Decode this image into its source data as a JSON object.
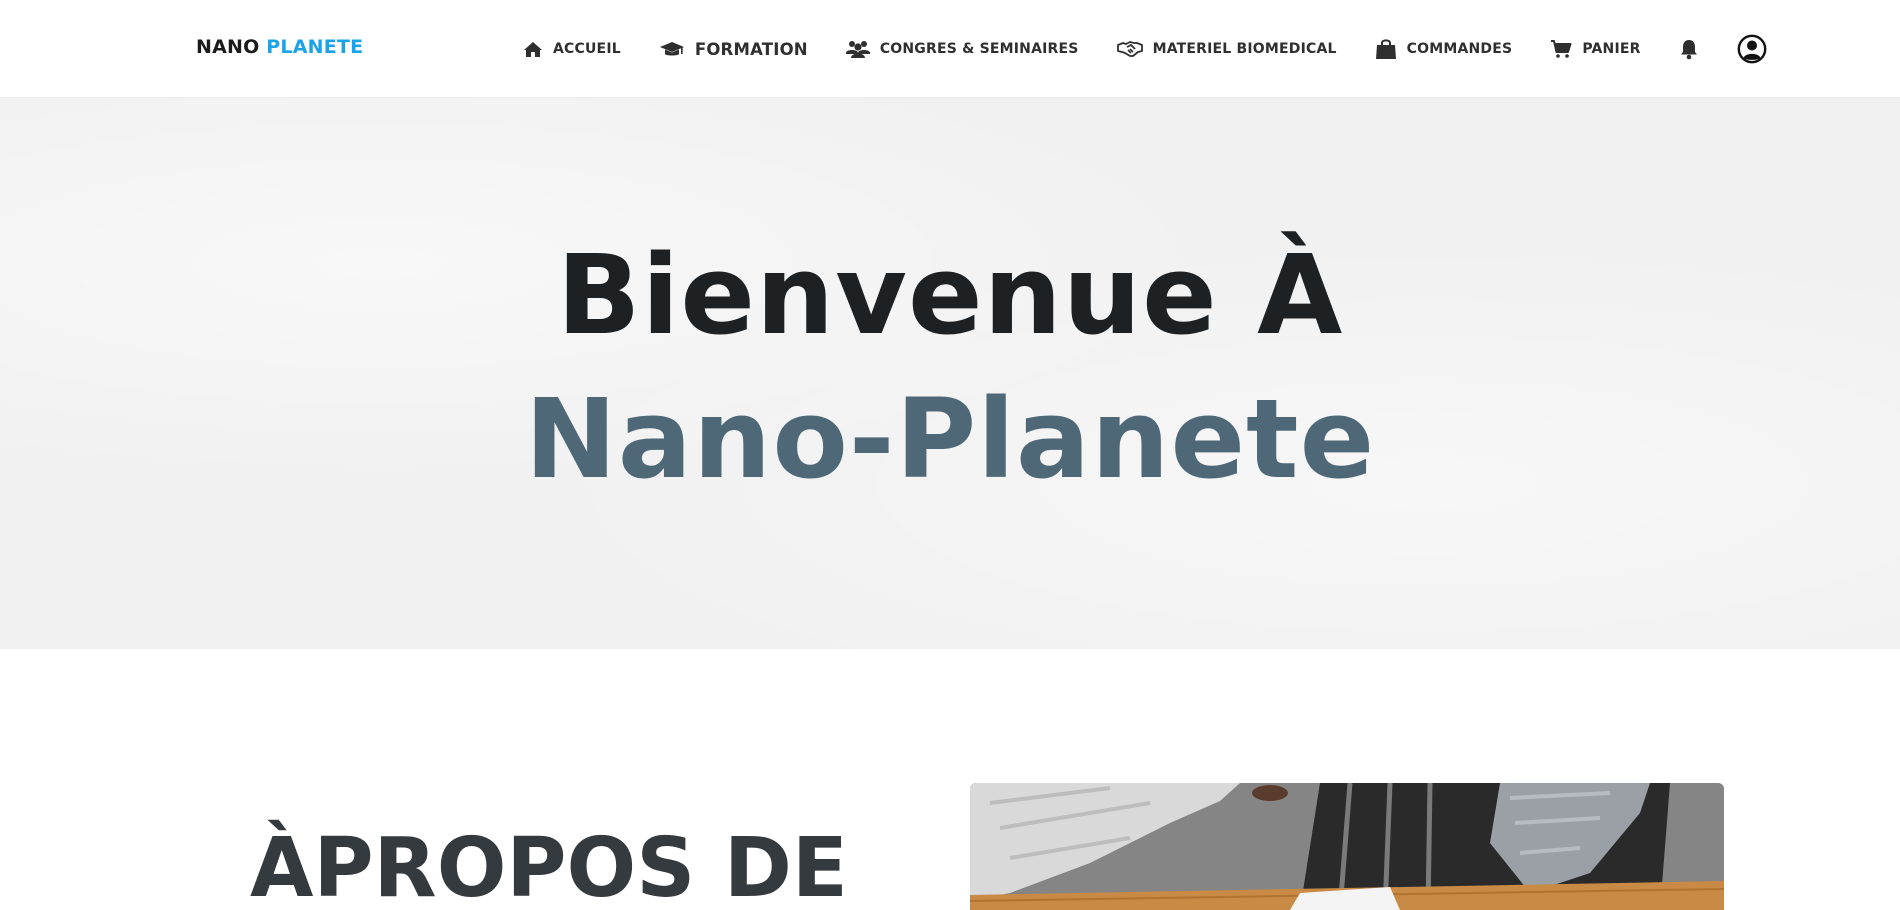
{
  "brand": {
    "part1": "NANO",
    "part2": "PLANETE"
  },
  "nav": {
    "accueil": "ACCUEIL",
    "formation": "FORMATION",
    "congres": "CONGRES & SEMINAIRES",
    "materiel": "MATERIEL BIOMEDICAL",
    "commandes": "COMMANDES",
    "panier": "PANIER"
  },
  "hero": {
    "line1": "Bienvenue À",
    "line2": "Nano-Planete"
  },
  "about": {
    "title": "ÀPROPOS DE"
  },
  "icons": {
    "home": "home-icon",
    "formation": "graduation-cap-icon",
    "congres": "users-icon",
    "materiel": "handshake-icon",
    "commandes": "shopping-bag-icon",
    "panier": "cart-icon",
    "notifications": "bell-icon",
    "account": "user-circle-icon"
  },
  "colors": {
    "brand_accent": "#1aa3e8",
    "hero_line2": "#4f6877"
  }
}
